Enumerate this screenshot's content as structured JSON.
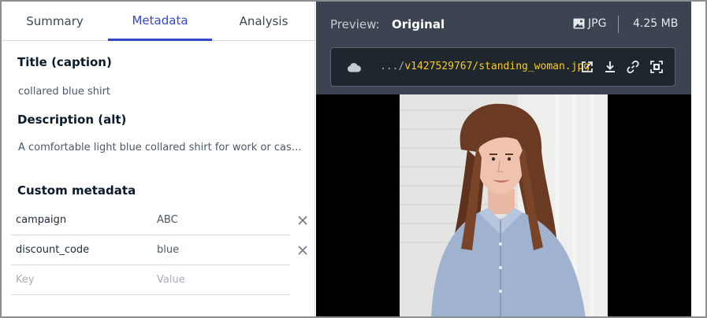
{
  "tabs": [
    {
      "label": "Summary",
      "active": false
    },
    {
      "label": "Metadata",
      "active": true
    },
    {
      "label": "Analysis",
      "active": false
    }
  ],
  "metadata": {
    "title_heading": "Title (caption)",
    "title_value": "collared blue shirt",
    "description_heading": "Description (alt)",
    "description_value": "A comfortable light blue collared shirt for work or casua...",
    "custom_heading": "Custom metadata",
    "custom_rows": [
      {
        "key": "campaign",
        "value": "ABC"
      },
      {
        "key": "discount_code",
        "value": "blue"
      }
    ],
    "key_placeholder": "Key",
    "value_placeholder": "Value"
  },
  "preview": {
    "label": "Preview:",
    "mode": "Original",
    "format": "JPG",
    "size": "4.25 MB",
    "url_prefix": ".../",
    "url_path": "v1427529767/standing_woman.jpg"
  },
  "icons": {
    "cloud": "cloud-icon",
    "image": "image-icon",
    "open_new": "open-external-icon",
    "download": "download-icon",
    "link": "link-icon",
    "focus": "focus-frame-icon",
    "close": "close-icon"
  },
  "colors": {
    "accent": "#3448c5",
    "url_text": "#f5cb29",
    "preview_header": "#3b4450"
  }
}
